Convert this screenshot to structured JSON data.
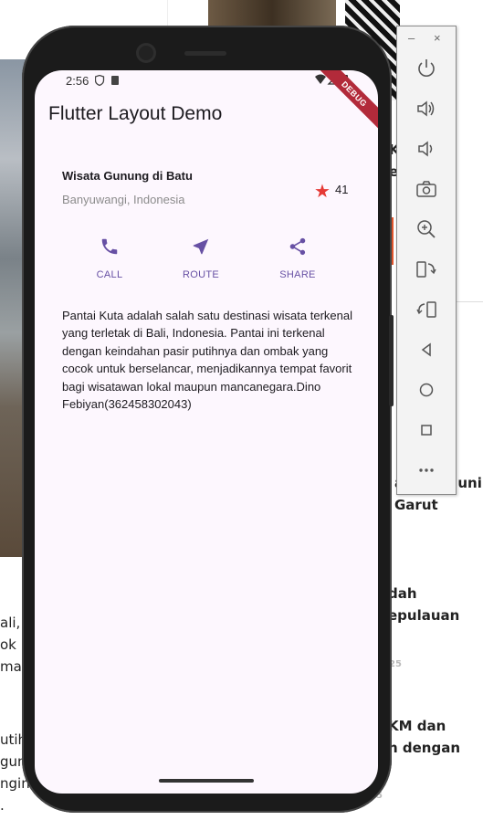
{
  "background": {
    "left_lines": [
      "ali,",
      "ok",
      "ma",
      "utih",
      "gun",
      "ngin",
      "."
    ],
    "right_lines": [
      "ahkan Huni",
      "Garut",
      "dah",
      "epulauan",
      "KM dan",
      "n dengan"
    ],
    "small_labels": [
      "25",
      "5"
    ],
    "top_fragments": [
      "K",
      "e"
    ]
  },
  "status_bar": {
    "time": "2:56",
    "debug_label": "DEBUG"
  },
  "app_bar": {
    "title": "Flutter Layout Demo"
  },
  "title_section": {
    "name": "Wisata Gunung di Batu",
    "location": "Banyuwangi, Indonesia",
    "star_count": "41"
  },
  "actions": [
    {
      "label": "CALL",
      "icon": "phone-icon"
    },
    {
      "label": "ROUTE",
      "icon": "navigation-icon"
    },
    {
      "label": "SHARE",
      "icon": "share-icon"
    }
  ],
  "description": "Pantai Kuta adalah salah satu destinasi wisata terkenal yang terletak di Bali, Indonesia. Pantai ini terkenal dengan keindahan pasir putihnya dan ombak yang cocok untuk berselancar, menjadikannya tempat favorit bagi wisatawan lokal maupun mancanegara.Dino Febiyan(362458302043)",
  "colors": {
    "primary": "#6750a4",
    "star": "#e53935",
    "screen_bg": "#fdf7fe",
    "debug_banner": "#b22a3a"
  },
  "emulator_toolbar": {
    "minimize": "–",
    "close": "×",
    "buttons": [
      "power-icon",
      "volume-up-icon",
      "volume-down-icon",
      "camera-icon",
      "zoom-icon",
      "rotate-left-icon",
      "rotate-right-icon",
      "back-icon",
      "home-icon",
      "overview-icon",
      "more-icon"
    ]
  }
}
